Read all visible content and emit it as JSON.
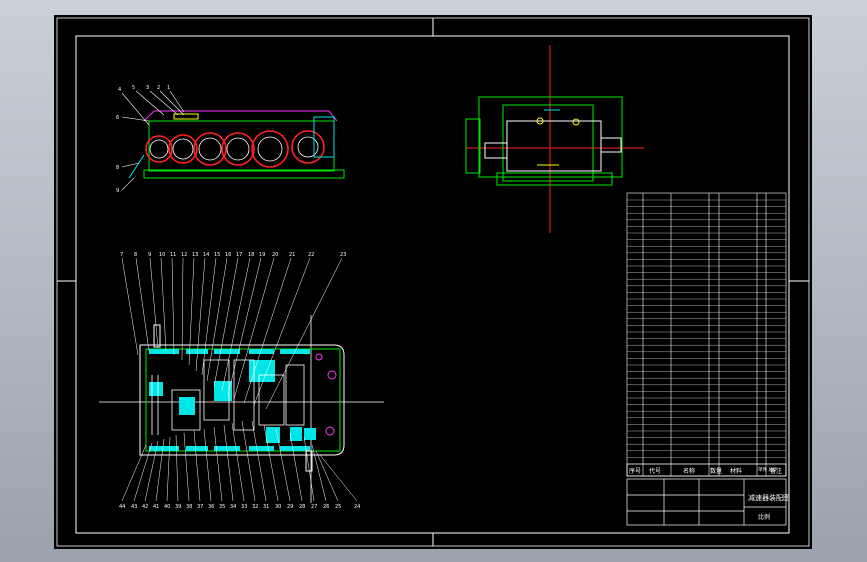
{
  "colors": {
    "background": "#000000",
    "frame": "#ffffff",
    "red": "#ff2020",
    "green": "#00e600",
    "cyan": "#00e6e6",
    "magenta": "#ff33ff",
    "yellow": "#ffff00",
    "white": "#ffffff"
  },
  "title_block": {
    "header": [
      "序号",
      "代号",
      "名称",
      "数量",
      "材料",
      "单件 总计",
      "备注"
    ],
    "drawing_title": "减速器装配图",
    "sheet_note": "比例"
  },
  "leader_labels": {
    "top_left_view": [
      "4",
      "5",
      "3",
      "2",
      "1",
      "6",
      "8",
      "9"
    ],
    "plan_view_top": [
      "7",
      "8",
      "9",
      "10",
      "11",
      "12",
      "13",
      "14",
      "15",
      "16",
      "17",
      "18",
      "19",
      "20",
      "21",
      "22",
      "23"
    ],
    "plan_view_bottom": [
      "44",
      "43",
      "42",
      "41",
      "40",
      "39",
      "38",
      "37",
      "36",
      "35",
      "34",
      "33",
      "32",
      "31",
      "30",
      "29",
      "28",
      "27",
      "26",
      "25",
      "24"
    ]
  }
}
